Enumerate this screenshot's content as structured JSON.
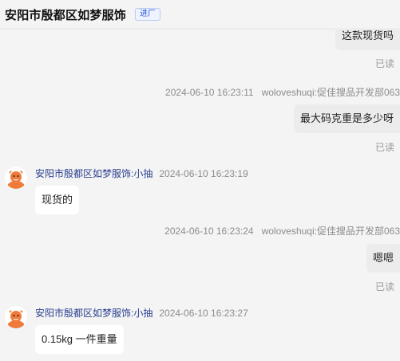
{
  "header": {
    "title": "安阳市殷都区如梦服饰",
    "tag": "进厂"
  },
  "messages": [
    {
      "kind": "bubble-right",
      "text": "这款现货吗"
    },
    {
      "kind": "read",
      "text": "已读"
    },
    {
      "kind": "meta-right",
      "time": "2024-06-10 16:23:11",
      "sender": "woloveshuqi:促佳搜品开发部063"
    },
    {
      "kind": "bubble-right",
      "text": "最大码克重是多少呀"
    },
    {
      "kind": "read",
      "text": "已读"
    },
    {
      "kind": "meta-left",
      "sender": "安阳市殷都区如梦服饰:小抽",
      "time": "2024-06-10 16:23:19"
    },
    {
      "kind": "bubble-left",
      "text": "现货的"
    },
    {
      "kind": "meta-right",
      "time": "2024-06-10 16:23:24",
      "sender": "woloveshuqi:促佳搜品开发部063"
    },
    {
      "kind": "bubble-right",
      "text": "嗯嗯"
    },
    {
      "kind": "read",
      "text": "已读"
    },
    {
      "kind": "meta-left",
      "sender": "安阳市殷都区如梦服饰:小抽",
      "time": "2024-06-10 16:23:27"
    },
    {
      "kind": "bubble-left",
      "text": "0.15kg 一件重量"
    }
  ],
  "colors": {
    "link_blue": "#2a3f8f",
    "avatar_orange": "#f07a3a"
  },
  "icons": {
    "avatar": "shop-mascot-avatar-icon"
  }
}
